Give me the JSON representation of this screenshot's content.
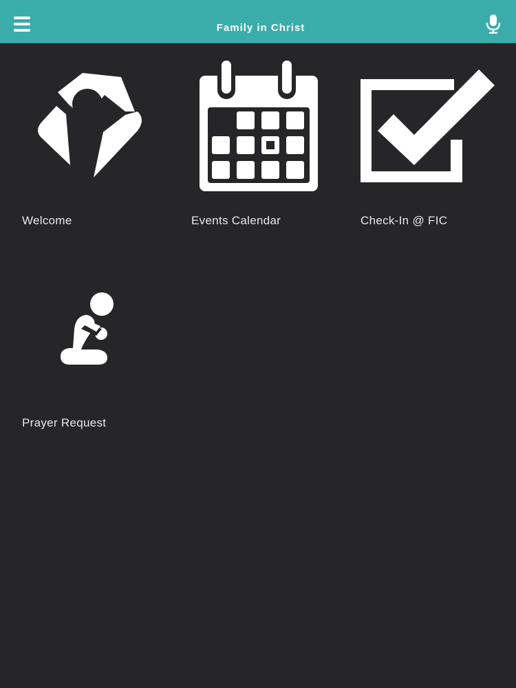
{
  "header": {
    "title": "Family in Christ",
    "menu_icon": "hamburger-menu-icon",
    "mic_icon": "microphone-icon",
    "background_color": "#3aadab"
  },
  "tiles": [
    {
      "label": "Welcome",
      "icon": "church-person-logo-icon"
    },
    {
      "label": "Events Calendar",
      "icon": "calendar-icon"
    },
    {
      "label": "Check-In @ FIC",
      "icon": "checkbox-checked-icon"
    },
    {
      "label": "Prayer Request",
      "icon": "kneeling-prayer-icon"
    }
  ],
  "colors": {
    "background": "#262628",
    "icon": "#ffffff",
    "label": "#e8e8e8"
  }
}
